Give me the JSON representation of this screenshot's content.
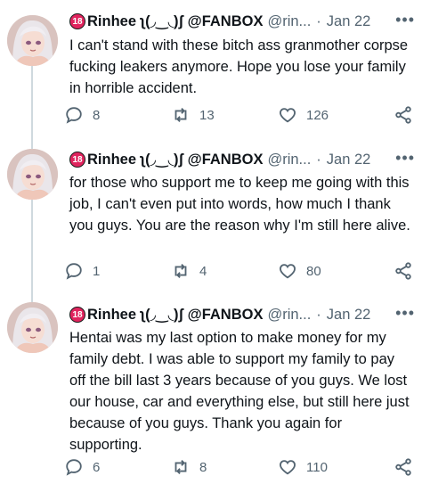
{
  "author": {
    "badge": "18",
    "display_name": "Rinhee ʅ(◞‿◟)ʃ @FANBOX",
    "handles": [
      "@rin...",
      "@rin...",
      "@rin..."
    ]
  },
  "tweets": [
    {
      "handle": "@rin...",
      "time": "Jan 22",
      "text": "I can't stand with these bitch ass granmother corpse fucking leakers anymore. Hope you lose your family in horrible accident.",
      "replies": "8",
      "retweets": "13",
      "likes": "126"
    },
    {
      "handle": "@rin...",
      "time": "Jan 22",
      "text": "for those who support me to keep me going with this job, I can't even put into words, how much I thank you guys. You are the reason why I'm still here alive.",
      "replies": "1",
      "retweets": "4",
      "likes": "80"
    },
    {
      "handle": "@rin...",
      "time": "Jan 22",
      "text": "Hentai was my last option to make money for my family debt. I was able to support my family to pay off the bill last 3 years because of you guys. We lost our house, car and everything else, but still here just because of you guys. Thank you again for supporting.",
      "replies": "6",
      "retweets": "8",
      "likes": "110"
    }
  ],
  "ui": {
    "separator": "·",
    "more": "•••",
    "icons": [
      "reply-icon",
      "retweet-icon",
      "like-icon",
      "share-icon",
      "more-icon"
    ]
  }
}
